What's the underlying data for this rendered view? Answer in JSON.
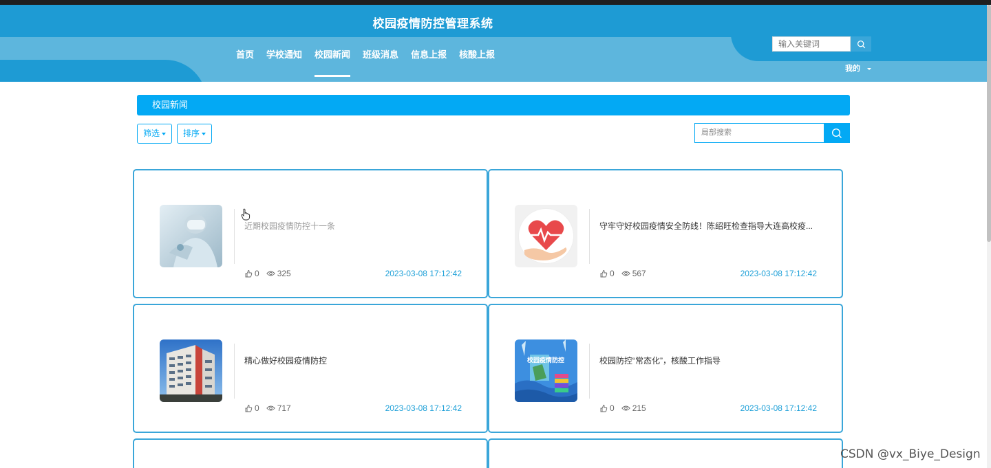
{
  "header": {
    "site_title": "校园疫情防控管理系统",
    "nav": [
      {
        "label": "首页"
      },
      {
        "label": "学校通知"
      },
      {
        "label": "校园新闻"
      },
      {
        "label": "班级消息"
      },
      {
        "label": "信息上报"
      },
      {
        "label": "核酸上报"
      }
    ],
    "active_nav": "校园新闻",
    "search_placeholder": "输入关键词",
    "user_menu": "我的"
  },
  "section": {
    "title": "校园新闻",
    "filter_label": "筛选",
    "sort_label": "排序",
    "local_search_placeholder": "局部搜索"
  },
  "colors": {
    "header_blue": "#1e9bd4",
    "header_light": "#5db6dd",
    "accent": "#03a9f4",
    "card_border": "#3aa6d9",
    "date_text": "#1ea0d8"
  },
  "news": [
    {
      "title": "近期校园疫情防控十一条",
      "likes": "0",
      "views": "325",
      "date": "2023-03-08 17:12:42",
      "thumb_icon": "doctor-photo"
    },
    {
      "title": "守牢守好校园疫情安全防线！陈绍旺检查指导大连高校疫...",
      "likes": "0",
      "views": "567",
      "date": "2023-03-08 17:12:42",
      "thumb_icon": "heart-hand-icon"
    },
    {
      "title": "精心做好校园疫情防控",
      "likes": "0",
      "views": "717",
      "date": "2023-03-08 17:12:42",
      "thumb_icon": "building-photo"
    },
    {
      "title": "校园防控“常态化”，核酸工作指导",
      "likes": "0",
      "views": "215",
      "date": "2023-03-08 17:12:42",
      "thumb_icon": "campus-poster",
      "thumb_text": "校园疫情防控"
    }
  ],
  "watermark": "CSDN @vx_Biye_Design"
}
